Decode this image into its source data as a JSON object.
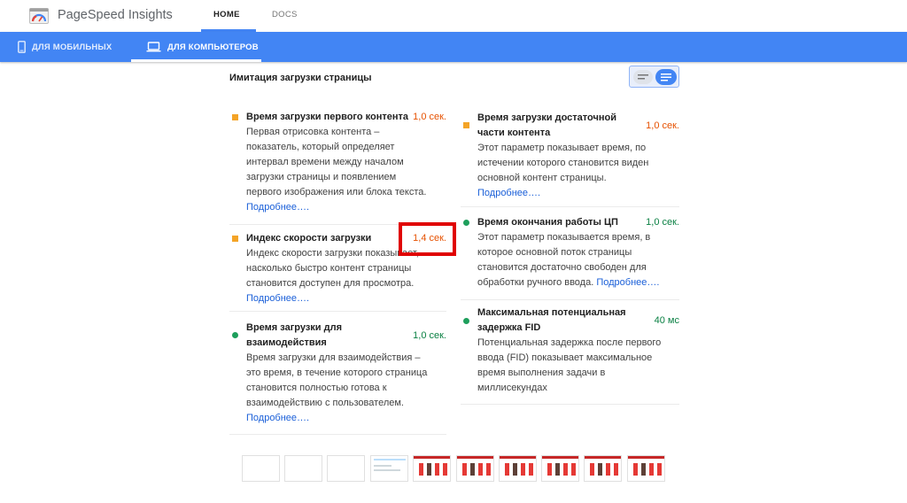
{
  "header": {
    "brand": "PageSpeed Insights",
    "tabs": [
      {
        "label": "HOME",
        "active": true
      },
      {
        "label": "DOCS",
        "active": false
      }
    ]
  },
  "device_tabs": [
    {
      "label": "ДЛЯ МОБИЛЬНЫХ",
      "icon": "phone-icon",
      "active": false
    },
    {
      "label": "ДЛЯ КОМПЬЮТЕРОВ",
      "icon": "laptop-icon",
      "active": true
    }
  ],
  "section": {
    "title": "Имитация загрузки страницы",
    "toggle": {
      "options": [
        "compact-view-icon",
        "expanded-view-icon"
      ],
      "selected": "expanded-view-icon"
    }
  },
  "colors": {
    "accent": "#4285f4",
    "average": "#f4a427",
    "fast": "#1e9f5c",
    "value_orange": "#e65100",
    "value_green": "#0a8043",
    "highlight": "#e00000"
  },
  "metrics_left": [
    {
      "title": "Время загрузки первого контента",
      "value": "1,0 сек.",
      "status": "average",
      "desc_lines": [
        "Первая отрисовка контента –",
        "показатель, который определяет",
        "интервал времени между началом",
        "загрузки страницы и появлением",
        "первого изображения или блока текста."
      ],
      "link": "Подробнее…."
    },
    {
      "title": "Индекс скорости загрузки",
      "value": "1,4 сек.",
      "status": "average",
      "desc_lines": [
        "Индекс скорости загрузки показывает,",
        "насколько быстро контент страницы",
        "становится доступен для просмотра."
      ],
      "link": "Подробнее…."
    },
    {
      "title_lines": [
        "Время загрузки для",
        "взаимодействия"
      ],
      "value": "1,0 сек.",
      "status": "fast",
      "desc_lines": [
        "Время загрузки для взаимодействия –",
        "это время, в течение которого страница",
        "становится полностью готова к",
        "взаимодействию с пользователем."
      ],
      "link": "Подробнее…."
    }
  ],
  "metrics_right": [
    {
      "title_lines": [
        "Время загрузки достаточной",
        "части контента"
      ],
      "value": "1,0 сек.",
      "status": "average",
      "desc_lines": [
        "Этот параметр показывает время, по",
        "истечении которого становится виден",
        "основной контент страницы."
      ],
      "link": "Подробнее…."
    },
    {
      "title": "Время окончания работы ЦП",
      "value": "1,0 сек.",
      "status": "fast",
      "desc_lines": [
        "Этот параметр показывается время, в",
        "которое основной поток страницы",
        "становится достаточно свободен для"
      ],
      "desc_last": "обработки ручного ввода.",
      "link": "Подробнее…."
    },
    {
      "title_lines": [
        "Максимальная потенциальная",
        "задержка FID"
      ],
      "value": "40 мс",
      "status": "fast",
      "desc_lines": [
        "Потенциальная задержка после первого",
        "ввода (FID) показывает максимальное",
        "время выполнения задачи в",
        "миллисекундах"
      ]
    }
  ],
  "filmstrip": {
    "frames": [
      "blank",
      "blank",
      "blank",
      "partial",
      "full",
      "full",
      "full",
      "full",
      "full",
      "full"
    ]
  }
}
